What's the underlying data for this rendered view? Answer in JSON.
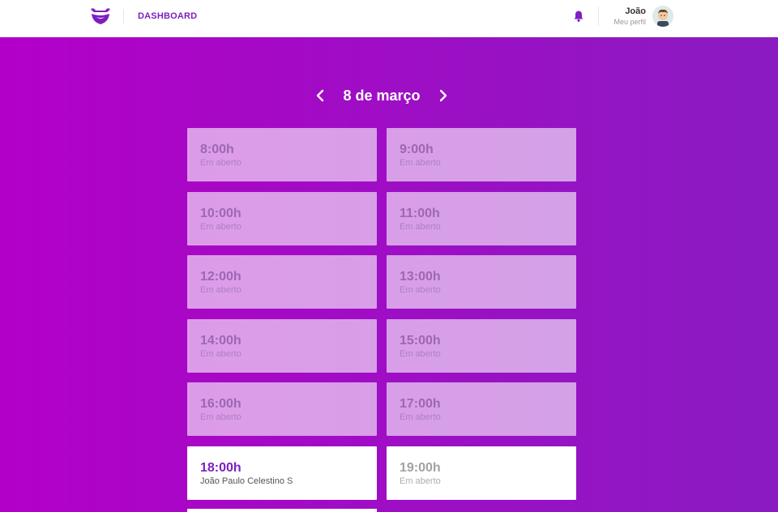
{
  "header": {
    "nav_label": "DASHBOARD",
    "user_name": "João",
    "profile_link": "Meu perfil"
  },
  "date_nav": {
    "date": "8 de março"
  },
  "slots": [
    {
      "time": "8:00h",
      "status": "Em aberto"
    },
    {
      "time": "9:00h",
      "status": "Em aberto"
    },
    {
      "time": "10:00h",
      "status": "Em aberto"
    },
    {
      "time": "11:00h",
      "status": "Em aberto"
    },
    {
      "time": "12:00h",
      "status": "Em aberto"
    },
    {
      "time": "13:00h",
      "status": "Em aberto"
    },
    {
      "time": "14:00h",
      "status": "Em aberto"
    },
    {
      "time": "15:00h",
      "status": "Em aberto"
    },
    {
      "time": "16:00h",
      "status": "Em aberto"
    },
    {
      "time": "17:00h",
      "status": "Em aberto"
    },
    {
      "time": "18:00h",
      "status": "João Paulo Celestino S"
    },
    {
      "time": "19:00h",
      "status": "Em aberto"
    }
  ],
  "colors": {
    "brand": "#7d1fc0",
    "gradient_start": "#b300c8",
    "gradient_end": "#8a1bc2"
  },
  "icons": [
    "logo-icon",
    "bell-icon",
    "chevron-left-icon",
    "chevron-right-icon",
    "avatar"
  ]
}
